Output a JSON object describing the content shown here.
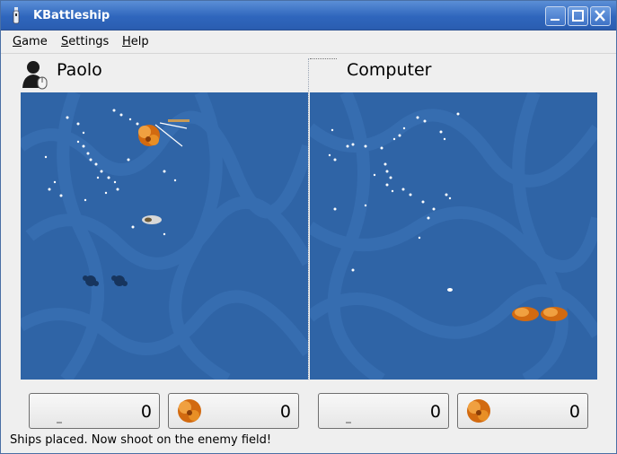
{
  "window": {
    "title": "KBattleship"
  },
  "menu": [
    {
      "mnemonic": "G",
      "rest": "ame"
    },
    {
      "mnemonic": "S",
      "rest": "ettings"
    },
    {
      "mnemonic": "H",
      "rest": "elp"
    }
  ],
  "players": {
    "left": {
      "name": "Paolo",
      "shots": "0",
      "hits": "0"
    },
    "right": {
      "name": "Computer",
      "shots": "0",
      "hits": "0"
    }
  },
  "status": "Ships placed. Now shoot on the enemy field!",
  "colors": {
    "sea": "#2f64a6",
    "titlebar": "#3a70c4",
    "explosion": "#e0801a"
  },
  "icons": [
    "app-icon",
    "minimize-icon",
    "maximize-icon",
    "close-icon",
    "user-avatar-icon",
    "explosion-icon"
  ]
}
